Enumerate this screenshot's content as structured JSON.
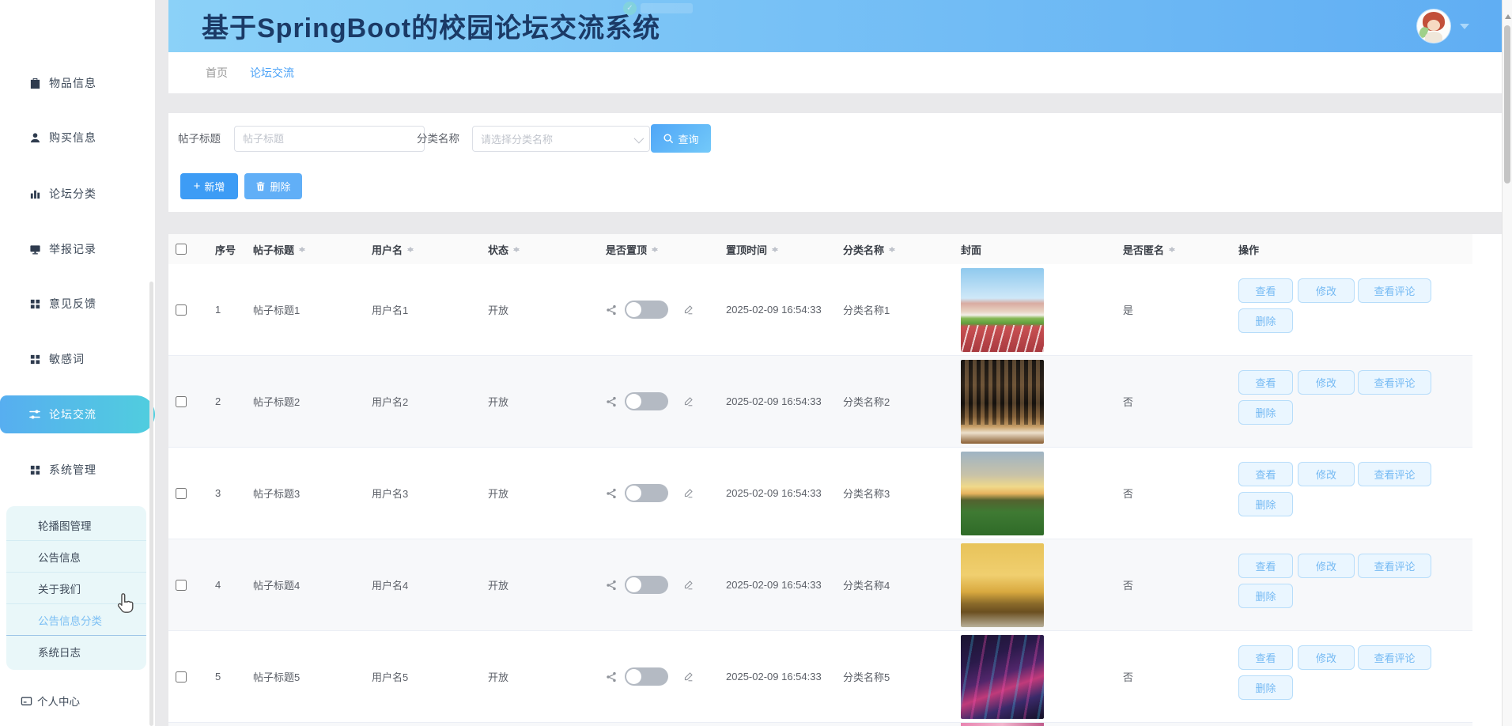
{
  "header": {
    "title": "基于SpringBoot的校园论坛交流系统"
  },
  "tabs": [
    {
      "label": "首页"
    },
    {
      "label": "论坛交流"
    }
  ],
  "sidebar": {
    "items": [
      {
        "label": "物品信息"
      },
      {
        "label": "购买信息"
      },
      {
        "label": "论坛分类"
      },
      {
        "label": "举报记录"
      },
      {
        "label": "意见反馈"
      },
      {
        "label": "敏感词"
      },
      {
        "label": "论坛交流"
      },
      {
        "label": "系统管理"
      }
    ],
    "submenu": [
      {
        "label": "轮播图管理"
      },
      {
        "label": "公告信息"
      },
      {
        "label": "关于我们"
      },
      {
        "label": "公告信息分类"
      },
      {
        "label": "系统日志"
      }
    ],
    "profile_label": "个人中心"
  },
  "search": {
    "title_label": "帖子标题",
    "title_placeholder": "帖子标题",
    "category_label": "分类名称",
    "category_placeholder": "请选择分类名称",
    "query_label": "查询"
  },
  "toolbar": {
    "add_label": "新增",
    "delete_label": "删除"
  },
  "table": {
    "columns": [
      {
        "label": "序号"
      },
      {
        "label": "帖子标题"
      },
      {
        "label": "用户名"
      },
      {
        "label": "状态"
      },
      {
        "label": "是否置顶"
      },
      {
        "label": "置顶时间"
      },
      {
        "label": "分类名称"
      },
      {
        "label": "封面"
      },
      {
        "label": "是否匿名"
      },
      {
        "label": "操作"
      }
    ],
    "actions": [
      "查看",
      "修改",
      "查看评论",
      "删除"
    ],
    "rows": [
      {
        "index": "1",
        "title": "帖子标题1",
        "user": "用户名1",
        "status": "开放",
        "time": "2025-02-09 16:54:33",
        "category": "分类名称1",
        "anonymous": "是",
        "cover_desc": "campus-running-track"
      },
      {
        "index": "2",
        "title": "帖子标题2",
        "user": "用户名2",
        "status": "开放",
        "time": "2025-02-09 16:54:33",
        "category": "分类名称2",
        "anonymous": "否",
        "cover_desc": "library-bookshelf"
      },
      {
        "index": "3",
        "title": "帖子标题3",
        "user": "用户名3",
        "status": "开放",
        "time": "2025-02-09 16:54:33",
        "category": "分类名称3",
        "anonymous": "否",
        "cover_desc": "sunset-meadow"
      },
      {
        "index": "4",
        "title": "帖子标题4",
        "user": "用户名4",
        "status": "开放",
        "time": "2025-02-09 16:54:33",
        "category": "分类名称4",
        "anonymous": "否",
        "cover_desc": "autumn-trees"
      },
      {
        "index": "5",
        "title": "帖子标题5",
        "user": "用户名5",
        "status": "开放",
        "time": "2025-02-09 16:54:33",
        "category": "分类名称5",
        "anonymous": "否",
        "cover_desc": "cyberpunk-figures"
      }
    ],
    "accent_color": "#409eff",
    "stripe_color": "#f7f8fa"
  }
}
